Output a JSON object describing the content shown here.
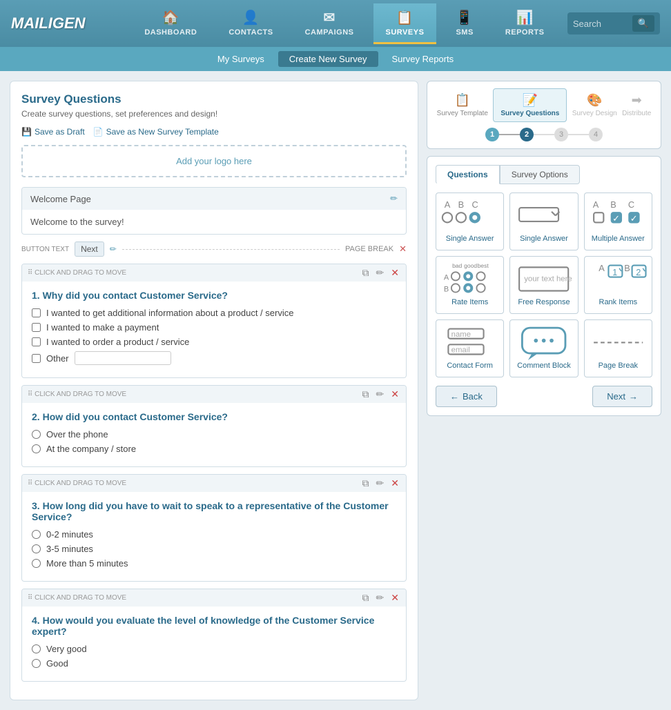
{
  "logo": "MAILIGEN",
  "nav": {
    "items": [
      {
        "id": "dashboard",
        "label": "DASHBOARD",
        "icon": "🏠"
      },
      {
        "id": "contacts",
        "label": "CONTACTS",
        "icon": "👤"
      },
      {
        "id": "campaigns",
        "label": "CAMPAIGNS",
        "icon": "✉"
      },
      {
        "id": "surveys",
        "label": "SURVEYS",
        "icon": "📋",
        "active": true
      },
      {
        "id": "sms",
        "label": "SMS",
        "icon": "📱"
      },
      {
        "id": "reports",
        "label": "REPORTS",
        "icon": "📊"
      }
    ],
    "search_placeholder": "Search"
  },
  "subnav": {
    "items": [
      {
        "label": "My Surveys"
      },
      {
        "label": "Create New Survey",
        "active": true
      },
      {
        "label": "Survey Reports"
      }
    ]
  },
  "wizard": {
    "steps": [
      {
        "num": "1",
        "label": "Survey Template",
        "state": "done"
      },
      {
        "num": "2",
        "label": "Survey Questions",
        "state": "active"
      },
      {
        "num": "3",
        "label": "Survey Design",
        "state": "inactive"
      },
      {
        "num": "4",
        "label": "Distribute",
        "state": "inactive"
      }
    ]
  },
  "left": {
    "title": "Survey Questions",
    "subtitle": "Create survey questions, set preferences and design!",
    "save_draft": "Save as Draft",
    "save_template": "Save as New Survey Template",
    "logo_placeholder": "Add your logo here",
    "welcome_page": {
      "title": "Welcome Page",
      "body": "Welcome to the survey!"
    },
    "button_text_label": "BUTTON TEXT",
    "next_btn": "Next",
    "page_break": "PAGE BREAK",
    "questions": [
      {
        "num": "1",
        "title": "Why did you contact Customer Service?",
        "type": "checkbox",
        "options": [
          "I wanted to get additional information about a product / service",
          "I wanted to make a payment",
          "I wanted to order a product / service"
        ],
        "has_other": true,
        "other_placeholder": ""
      },
      {
        "num": "2",
        "title": "How did you contact Customer Service?",
        "type": "radio",
        "options": [
          "Over the phone",
          "At the company / store"
        ]
      },
      {
        "num": "3",
        "title": "How long did you have to wait to speak to a representative of the Customer Service?",
        "type": "radio",
        "options": [
          "0-2 minutes",
          "3-5 minutes",
          "More than 5 minutes"
        ]
      },
      {
        "num": "4",
        "title": "How would you evaluate the level of knowledge of the Customer Service expert?",
        "type": "radio",
        "options": [
          "Very good",
          "Good"
        ]
      }
    ]
  },
  "right": {
    "tabs": [
      {
        "label": "Questions",
        "active": true
      },
      {
        "label": "Survey Options"
      }
    ],
    "question_types": [
      {
        "id": "single-radio",
        "label": "Single Answer",
        "icon_type": "radio"
      },
      {
        "id": "single-dropdown",
        "label": "Single Answer",
        "icon_type": "dropdown"
      },
      {
        "id": "multiple",
        "label": "Multiple Answer",
        "icon_type": "checkbox"
      },
      {
        "id": "rate",
        "label": "Rate Items",
        "icon_type": "rate"
      },
      {
        "id": "free",
        "label": "Free Response",
        "icon_type": "free"
      },
      {
        "id": "rank",
        "label": "Rank Items",
        "icon_type": "rank"
      },
      {
        "id": "contact",
        "label": "Contact Form",
        "icon_type": "contact"
      },
      {
        "id": "comment",
        "label": "Comment Block",
        "icon_type": "comment"
      },
      {
        "id": "pagebreak",
        "label": "Page Break",
        "icon_type": "pagebreak"
      }
    ],
    "back_btn": "Back",
    "next_btn": "Next"
  }
}
